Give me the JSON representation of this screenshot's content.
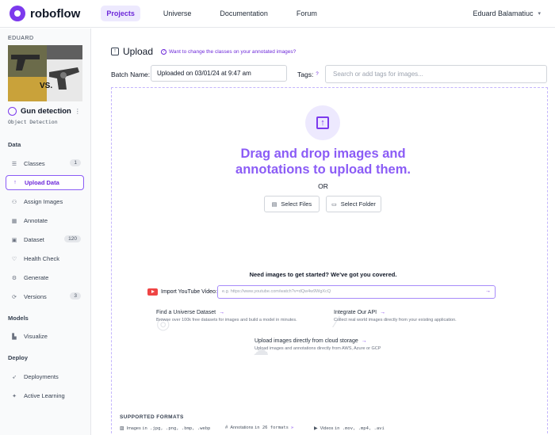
{
  "brand": {
    "name": "roboflow"
  },
  "nav": {
    "items": [
      "Projects",
      "Universe",
      "Documentation",
      "Forum"
    ],
    "active": "Projects"
  },
  "user": {
    "name": "Eduard Balamatiuc"
  },
  "sidebar": {
    "workspace": "EDUARD",
    "project_name": "Gun detection",
    "project_type": "Object Detection",
    "thumbnail_text": "VS.",
    "sections": {
      "data": "Data",
      "models": "Models",
      "deploy": "Deploy"
    },
    "items": [
      {
        "label": "Classes",
        "icon": "list-icon",
        "badge": "1"
      },
      {
        "label": "Upload Data",
        "icon": "upload-arrow-icon",
        "active": true
      },
      {
        "label": "Assign Images",
        "icon": "users-icon"
      },
      {
        "label": "Annotate",
        "icon": "annotate-grid-icon"
      },
      {
        "label": "Dataset",
        "icon": "dataset-icon",
        "badge": "120"
      },
      {
        "label": "Health Check",
        "icon": "heart-icon"
      },
      {
        "label": "Generate",
        "icon": "generate-icon"
      },
      {
        "label": "Versions",
        "icon": "versions-icon",
        "badge": "3"
      },
      {
        "label": "Visualize",
        "icon": "chart-icon"
      },
      {
        "label": "Deployments",
        "icon": "rocket-icon"
      },
      {
        "label": "Active Learning",
        "icon": "active-learning-icon"
      }
    ]
  },
  "main": {
    "title": "Upload",
    "help_link": "Want to change the classes on your annotated images?",
    "batch_label": "Batch Name:",
    "batch_value": "Uploaded on 03/01/24 at 9:47 am",
    "tags_label": "Tags:",
    "tags_placeholder": "Search or add tags for images...",
    "drop_title_line1": "Drag and drop images and",
    "drop_title_line2": "annotations to upload them.",
    "or_text": "OR",
    "select_files": "Select Files",
    "select_folder": "Select Folder",
    "need_images": "Need images to get started? We've got you covered.",
    "youtube_label": "Import YouTube Video:",
    "youtube_placeholder": "e.g. https://www.youtube.com/watch?v=dQw4w9WgXcQ",
    "options": [
      {
        "title": "Find a Universe Dataset",
        "desc": "Browse over 100k free datasets for images and build a model in minutes."
      },
      {
        "title": "Integrate Our API",
        "desc": "Collect real world images directly from your existing application."
      },
      {
        "title": "Upload images directly from cloud storage",
        "desc": "Upload images and annotations directly from AWS, Azure or GCP"
      }
    ],
    "formats_title": "SUPPORTED FORMATS",
    "formats": {
      "images_label": "Images",
      "images_list": "in .jpg, .png, .bmp, .webp",
      "annotations_label": "Annotations",
      "annotations_list": "in 26 formats",
      "videos_label": "Videos",
      "videos_list": "in .mov, .mp4, .avi"
    }
  },
  "colors": {
    "accent": "#7c3aed",
    "accent_light": "#ede9fe",
    "youtube": "#ef4444"
  }
}
